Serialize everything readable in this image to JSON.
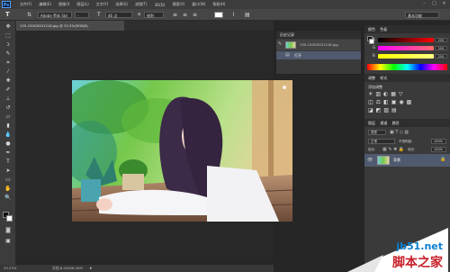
{
  "app": {
    "logo": "Ps"
  },
  "menu": [
    "文件(F)",
    "编辑(E)",
    "图像(I)",
    "图层(L)",
    "文字(Y)",
    "选择(S)",
    "滤镜(T)",
    "3D(D)",
    "视图(V)",
    "窗口(W)",
    "帮助(H)"
  ],
  "options": {
    "font_family": "Adobe 黑体 Std",
    "font_style": "-",
    "font_size": "46 点",
    "aa": "锐利",
    "workspace": "基本功能"
  },
  "document": {
    "tab_title": "135-150G9251218.jpg @ 33.3%(RGB/8)",
    "zoom": "33.33%",
    "doc_info": "文档:6.00M/6.00M"
  },
  "history": {
    "tabs": [
      "历史记录"
    ],
    "snapshot": "135-150G9251218.jpg",
    "state": "打开"
  },
  "color_panel": {
    "tabs": [
      "颜色",
      "色板"
    ],
    "r_label": "R",
    "g_label": "G",
    "b_label": "B",
    "r": "255",
    "g": "255",
    "b": "255"
  },
  "adjust_panel": {
    "tabs": [
      "调整",
      "样式"
    ],
    "title": "添加调整"
  },
  "layers_panel": {
    "tabs": [
      "图层",
      "通道",
      "路径"
    ],
    "kind": "类型",
    "blend": "正常",
    "opacity_label": "不透明度:",
    "opacity": "100%",
    "lock_label": "锁定:",
    "fill_label": "填充:",
    "fill": "100%",
    "layer_name": "背景"
  },
  "watermark": {
    "site": "jb51.net",
    "name": "脚本之家"
  },
  "colors": {
    "accent": "#4fa3ff",
    "panel_bg": "#3a3a3a",
    "workspace_bg": "#282828"
  }
}
